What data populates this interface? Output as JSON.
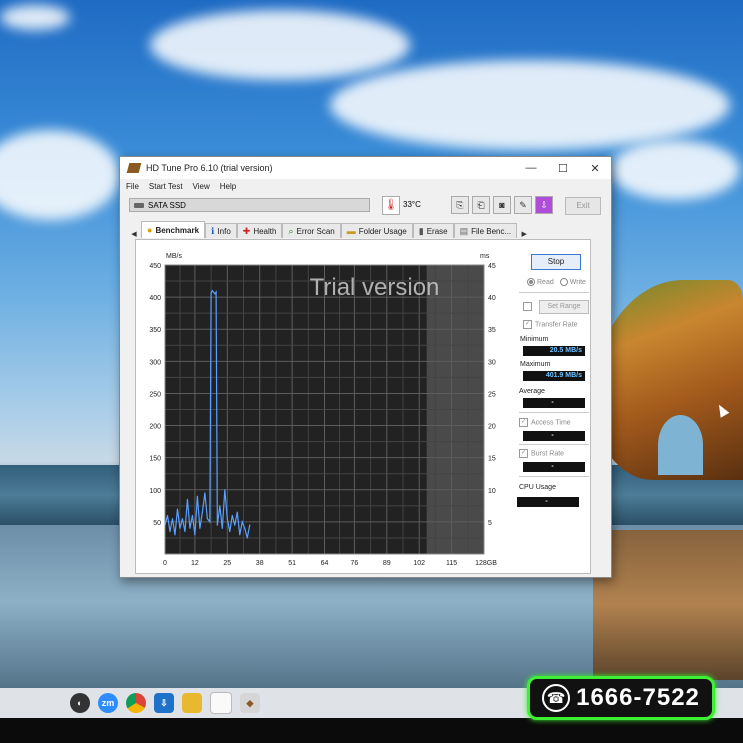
{
  "window": {
    "title": "HD Tune Pro 6.10 (trial version)",
    "minimize": "—",
    "maximize": "☐",
    "close": "✕"
  },
  "menu": [
    "File",
    "Start Test",
    "View",
    "Help"
  ],
  "toolbar": {
    "drive": "SATA SSD",
    "temperature": "33°C",
    "exit_label": "Exit"
  },
  "tabs": [
    {
      "label": "Benchmark",
      "icon": "benchmark-icon",
      "active": true
    },
    {
      "label": "Info",
      "icon": "info-icon"
    },
    {
      "label": "Health",
      "icon": "health-icon"
    },
    {
      "label": "Error Scan",
      "icon": "error-scan-icon"
    },
    {
      "label": "Folder Usage",
      "icon": "folder-icon"
    },
    {
      "label": "Erase",
      "icon": "erase-icon"
    },
    {
      "label": "File Benc...",
      "icon": "file-benchmark-icon"
    }
  ],
  "side": {
    "stop_label": "Stop",
    "read_label": "Read",
    "write_label": "Write",
    "set_range_label": "Set Range",
    "transfer_rate_label": "Transfer Rate",
    "minimum_label": "Minimum",
    "minimum_value": "20.5 MB/s",
    "maximum_label": "Maximum",
    "maximum_value": "401.9 MB/s",
    "average_label": "Average",
    "average_value": "-",
    "access_time_label": "Access Time",
    "access_time_value": "-",
    "burst_rate_label": "Burst Rate",
    "burst_rate_value": "-",
    "cpu_usage_label": "CPU Usage",
    "cpu_usage_value": "-"
  },
  "chart_data": {
    "type": "line",
    "title": "",
    "watermark": "Trial version",
    "y_left_unit": "MB/s",
    "y_right_unit": "ms",
    "ylim": [
      0,
      450
    ],
    "yticks_left": [
      50,
      100,
      150,
      200,
      250,
      300,
      350,
      400,
      450
    ],
    "ylim_right": [
      0,
      45
    ],
    "yticks_right": [
      5,
      10,
      15,
      20,
      25,
      30,
      35,
      40,
      45
    ],
    "xlim": [
      0,
      128
    ],
    "xticks": [
      0,
      12,
      25,
      38,
      51,
      64,
      76,
      89,
      102,
      115,
      128
    ],
    "xtick_labels": [
      "0",
      "12",
      "25",
      "38",
      "51",
      "64",
      "76",
      "89",
      "102",
      "115",
      "128GB"
    ],
    "grid": true,
    "series": [
      {
        "color": "#5aa0ff",
        "x": [
          0,
          1,
          2,
          3,
          4,
          5,
          6,
          7,
          8,
          9,
          10,
          11,
          12,
          13,
          14,
          15,
          16,
          17,
          18,
          18.5,
          19,
          20,
          20.5,
          21,
          22,
          23,
          24,
          25,
          26,
          27,
          28,
          29,
          30,
          31,
          32,
          33,
          34
        ],
        "y": [
          45,
          60,
          35,
          55,
          30,
          70,
          40,
          55,
          35,
          85,
          40,
          60,
          30,
          90,
          40,
          65,
          95,
          55,
          50,
          407,
          410,
          405,
          408,
          45,
          75,
          40,
          100,
          55,
          35,
          60,
          45,
          65,
          30,
          50,
          40,
          25,
          45
        ]
      }
    ],
    "shaded_region": [
      105,
      128
    ]
  },
  "taskbar": {
    "icons": [
      "camera-app-icon",
      "zoom-icon",
      "chrome-icon",
      "store-icon",
      "folder-icon",
      "blank-file-icon",
      "hdtune-icon"
    ],
    "zoom_label": "zm"
  },
  "phone_badge": {
    "number": "1666-7522",
    "icon": "☎"
  }
}
